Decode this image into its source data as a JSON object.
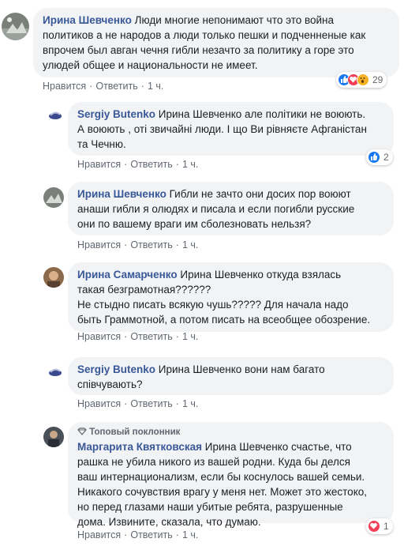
{
  "comments": [
    {
      "author": "Ирина Шевченко",
      "lines": [
        "Люди многие непонимают что это война",
        "политиков а не народов а люди только пешки и подченненые как",
        "впрочем был авган чечня гибли незачто за политику а горе это",
        "улюдей общее и национальности не имеет."
      ],
      "like_label": "Нравится",
      "reply_label": "Ответить",
      "time": "1 ч.",
      "reaction_count": "29"
    },
    {
      "author": "Sergiy Butenko",
      "lines": [
        "Ирина Шевченко але політики не воюють.",
        "А воюють , оті звичайні люди. І що Ви рівняєте Афганістан",
        "та Чечню."
      ],
      "like_label": "Нравится",
      "reply_label": "Ответить",
      "time": "1 ч.",
      "reaction_count": "2"
    },
    {
      "author": "Ирина Шевченко",
      "lines": [
        "Гибли не зачто они досих пор воюют",
        "анаши гибли я олюдях и писала и если погибли русские",
        "они по вашему враги им сболезновать нельзя?"
      ],
      "like_label": "Нравится",
      "reply_label": "Ответить",
      "time": "1 ч."
    },
    {
      "author": "Ирина Самарченко",
      "lines": [
        "Ирина Шевченко откуда взялась",
        "такая безграмотная??????",
        "Не стыдно писать всякую чушь????? Для начала надо",
        "быть Граммотной, а потом писать на всеобщее обозрение."
      ],
      "like_label": "Нравится",
      "reply_label": "Ответить",
      "time": "1 ч."
    },
    {
      "author": "Sergiy Butenko",
      "lines": [
        "Ирина Шевченко вони нам багато",
        "співчувають?"
      ],
      "like_label": "Нравится",
      "reply_label": "Ответить",
      "time": "1 ч."
    },
    {
      "badge": "Топовый поклонник",
      "author": "Маргарита Квятковская",
      "lines": [
        "Ирина Шевченко счастье, что",
        "рашка не убила никого из вашей родни. Куда бы делся",
        "ваш интернационализм, если бы коснулось вашей семьи.",
        "Никакого сочувствия врагу у меня нет. Может это жестоко,",
        "но перед глазами наши убитые ребята, разрушенные",
        "дома. Извините, сказала, что думаю."
      ],
      "like_label": "Нравится",
      "reply_label": "Ответить",
      "time": "1 ч.",
      "reaction_count": "1"
    }
  ],
  "colors": {
    "author": "#385898",
    "bubble": "#f2f3f5",
    "meta": "#606770",
    "like": "#1877f2",
    "love": "#f33e58",
    "wow": "#f7b125"
  },
  "icons": {
    "top_fan": "diamond-icon",
    "reactions": [
      "like-icon",
      "love-icon",
      "wow-icon"
    ]
  }
}
